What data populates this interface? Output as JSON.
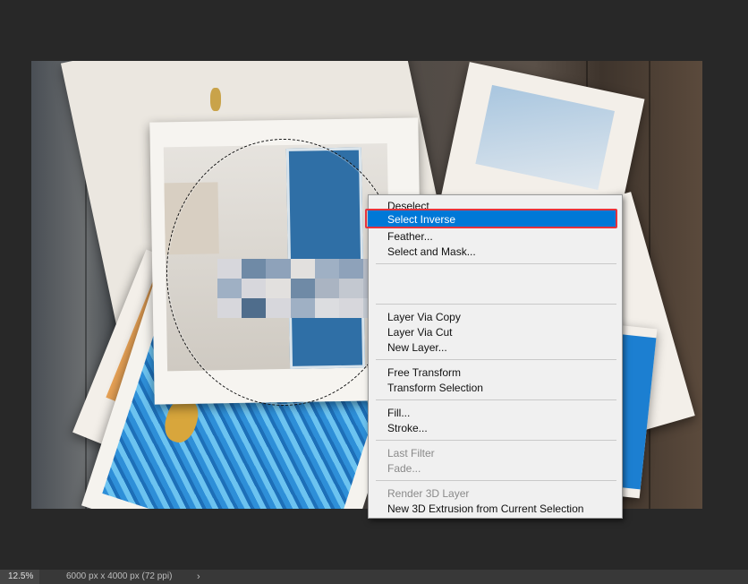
{
  "context_menu": {
    "items": [
      {
        "label": "Deselect",
        "enabled": true
      },
      {
        "label": "Select Inverse",
        "enabled": true,
        "highlighted": true
      },
      {
        "label": "Feather...",
        "enabled": true
      },
      {
        "label": "Select and Mask...",
        "enabled": true
      },
      {
        "label": "Layer Via Copy",
        "enabled": true
      },
      {
        "label": "Layer Via Cut",
        "enabled": true
      },
      {
        "label": "New Layer...",
        "enabled": true
      },
      {
        "label": "Free Transform",
        "enabled": true
      },
      {
        "label": "Transform Selection",
        "enabled": true
      },
      {
        "label": "Fill...",
        "enabled": true
      },
      {
        "label": "Stroke...",
        "enabled": true
      },
      {
        "label": "Last Filter",
        "enabled": false
      },
      {
        "label": "Fade...",
        "enabled": false
      },
      {
        "label": "Render 3D Layer",
        "enabled": false
      },
      {
        "label": "New 3D Extrusion from Current Selection",
        "enabled": true
      }
    ]
  },
  "status_bar": {
    "zoom": "12.5%",
    "document_size": "6000 px x 4000 px (72 ppi)",
    "arrow": "›"
  },
  "colors": {
    "highlight": "#0078d7",
    "annotation_frame": "#e6323c",
    "workspace_bg": "#282828"
  }
}
